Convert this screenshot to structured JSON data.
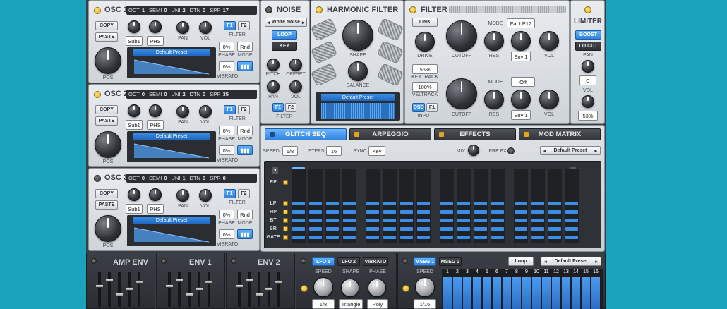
{
  "osc": [
    {
      "title": "OSC 1",
      "oct_label": "OCT",
      "oct": "1",
      "semi_label": "SEMI",
      "semi": "0",
      "uni_label": "UNI",
      "uni": "2",
      "dtn_label": "DTN",
      "dtn": "0",
      "spr_label": "SPR",
      "spr": "17",
      "copy": "COPY",
      "paste": "PASTE",
      "sub": "Sub1",
      "phs": "PHS",
      "pan": "PAN",
      "vol": "VOL",
      "f1": "F1",
      "f2": "F2",
      "filter": "FILTER",
      "phase_val": "0%",
      "rnd": "Rnd",
      "phase": "PHASE",
      "mode": "MODE",
      "vib_val": "0%",
      "vibrato": "VIBRATO",
      "preset": "Default Preset",
      "pos": "POS",
      "led_on": true
    },
    {
      "title": "OSC 2",
      "oct_label": "OCT",
      "oct": "0",
      "semi_label": "SEMI",
      "semi": "0",
      "uni_label": "UNI",
      "uni": "2",
      "dtn_label": "DTN",
      "dtn": "0",
      "spr_label": "SPR",
      "spr": "35",
      "copy": "COPY",
      "paste": "PASTE",
      "sub": "Sub1",
      "phs": "PHS",
      "pan": "PAN",
      "vol": "VOL",
      "f1": "F1",
      "f2": "F2",
      "filter": "FILTER",
      "phase_val": "0%",
      "rnd": "Rnd",
      "phase": "PHASE",
      "mode": "MODE",
      "vib_val": "0%",
      "vibrato": "VIBRATO",
      "preset": "Default Preset",
      "pos": "POS",
      "led_on": true
    },
    {
      "title": "OSC 3",
      "oct_label": "OCT",
      "oct": "0",
      "semi_label": "SEMI",
      "semi": "0",
      "uni_label": "UNI",
      "uni": "1",
      "dtn_label": "DTN",
      "dtn": "0",
      "spr_label": "SPR",
      "spr": "0",
      "copy": "COPY",
      "paste": "PASTE",
      "sub": "Sub1",
      "phs": "PHS",
      "pan": "PAN",
      "vol": "VOL",
      "f1": "F1",
      "f2": "F2",
      "filter": "FILTER",
      "phase_val": "0%",
      "rnd": "Rnd",
      "phase": "PHASE",
      "mode": "MODE",
      "vib_val": "0%",
      "vibrato": "VIBRATO",
      "preset": "Default Preset",
      "pos": "POS",
      "led_on": false
    }
  ],
  "noise": {
    "title": "NOISE",
    "type": "White Noise",
    "loop": "LOOP",
    "key": "KEY",
    "pitch": "PITCH",
    "offset": "OFFSET",
    "pan": "PAN",
    "vol": "VOL",
    "f1": "F1",
    "f2": "F2",
    "filter": "FILTER"
  },
  "harmonic": {
    "title": "HARMONIC FILTER",
    "shape": "SHAPE",
    "balance": "BALANCE",
    "preset": "Default Preset"
  },
  "filter": {
    "title": "FILTER",
    "link": "LINK",
    "mode": "MODE",
    "mode1": "Fat LP12",
    "drive": "DRIVE",
    "cutoff": "CUTOFF",
    "res": "RES",
    "env1": "Env 1",
    "vol": "VOL",
    "keytrack_val": "56%",
    "keytrack": "KEYTRACK",
    "veltrack_val": "100%",
    "veltrack": "VELTRACK",
    "osc": "OSC",
    "f1": "F1",
    "input": "INPUT",
    "mode2": "Off",
    "env2": "Env 1",
    "cutoff2": "CUTOFF",
    "res2": "RES",
    "vol2": "VOL"
  },
  "limiter": {
    "title": "LIMITER",
    "boost": "BOOST",
    "locut": "LO CUT",
    "pan": "PAN",
    "pan_val": "C",
    "vol": "VOL",
    "vol_val": "53%"
  },
  "tabs": [
    {
      "label": "GLITCH SEQ",
      "active": true
    },
    {
      "label": "ARPEGGIO",
      "active": false
    },
    {
      "label": "EFFECTS",
      "active": false
    },
    {
      "label": "MOD MATRIX",
      "active": false
    }
  ],
  "seq": {
    "speed_label": "SPEED",
    "speed": "1/8",
    "steps_label": "STEPS",
    "steps": "16",
    "sync_label": "SYNC",
    "sync": "Key",
    "mix": "MIX",
    "prefx": "PRE FX",
    "preset": "Default Preset",
    "rows": [
      "RP",
      "LP",
      "HP",
      "BT",
      "SR",
      "GATE"
    ],
    "r": "R"
  },
  "env": {
    "amp": "AMP ENV",
    "env1": "ENV 1",
    "env2": "ENV 2"
  },
  "lfo": {
    "tabs": [
      "LFO 1",
      "LFO 2",
      "VIBRATO"
    ],
    "speed": "SPEED",
    "shape": "SHAPE",
    "phase": "PHASE",
    "speed_val": "1/8",
    "shape_val": "Triangle",
    "phase_val": "Poly"
  },
  "mseg": {
    "tabs": [
      "MSEG 1",
      "MSEG 2"
    ],
    "loop": "Loop",
    "preset": "Default Preset",
    "speed": "SPEED",
    "speed_val": "1/16",
    "steps": [
      "1",
      "2",
      "3",
      "4",
      "5",
      "6",
      "7",
      "8",
      "9",
      "10",
      "11",
      "12",
      "13",
      "14",
      "15",
      "16"
    ]
  }
}
